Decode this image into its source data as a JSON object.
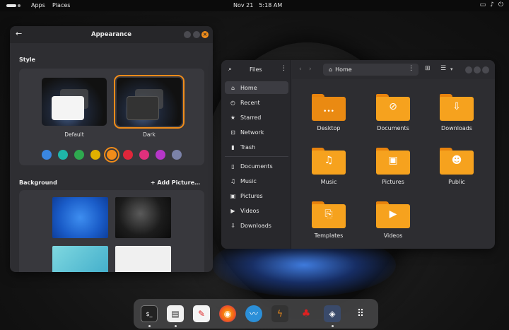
{
  "topbar": {
    "apps": "Apps",
    "places": "Places",
    "date": "Nov 21",
    "time": "5:18 AM",
    "icons": [
      "display-icon",
      "volume-icon",
      "power-icon"
    ]
  },
  "appearance": {
    "title": "Appearance",
    "style_heading": "Style",
    "themes": [
      {
        "label": "Default",
        "selected": false
      },
      {
        "label": "Dark",
        "selected": true
      }
    ],
    "accent_colors": [
      "#3a86e0",
      "#1fb5a9",
      "#2ea94f",
      "#e0b000",
      "#f08c1a",
      "#e0263a",
      "#e0307c",
      "#b636c8",
      "#7b82a8"
    ],
    "selected_accent": "#f08c1a",
    "background_heading": "Background",
    "add_picture": "Add Picture…"
  },
  "files": {
    "title": "Files",
    "path": "Home",
    "sidebar": [
      {
        "label": "Home",
        "icon": "home-icon",
        "active": true
      },
      {
        "label": "Recent",
        "icon": "clock-icon"
      },
      {
        "label": "Starred",
        "icon": "star-icon"
      },
      {
        "label": "Network",
        "icon": "network-icon"
      },
      {
        "label": "Trash",
        "icon": "trash-icon"
      },
      {
        "label": "Documents",
        "icon": "document-icon"
      },
      {
        "label": "Music",
        "icon": "music-icon"
      },
      {
        "label": "Pictures",
        "icon": "picture-icon"
      },
      {
        "label": "Videos",
        "icon": "video-icon"
      },
      {
        "label": "Downloads",
        "icon": "download-icon"
      }
    ],
    "folders": [
      {
        "label": "Desktop",
        "icon": "desktop-folder-icon"
      },
      {
        "label": "Documents",
        "icon": "documents-folder-icon"
      },
      {
        "label": "Downloads",
        "icon": "downloads-folder-icon"
      },
      {
        "label": "Music",
        "icon": "music-folder-icon"
      },
      {
        "label": "Pictures",
        "icon": "pictures-folder-icon"
      },
      {
        "label": "Public",
        "icon": "public-folder-icon"
      },
      {
        "label": "Templates",
        "icon": "templates-folder-icon"
      },
      {
        "label": "Videos",
        "icon": "videos-folder-icon"
      }
    ]
  },
  "dock": {
    "apps": [
      "terminal-icon",
      "file-manager-icon",
      "text-editor-icon",
      "firefox-icon",
      "kali-app-icon",
      "burp-suite-icon",
      "cherrytree-icon",
      "metasploit-icon",
      "show-apps-icon"
    ]
  }
}
